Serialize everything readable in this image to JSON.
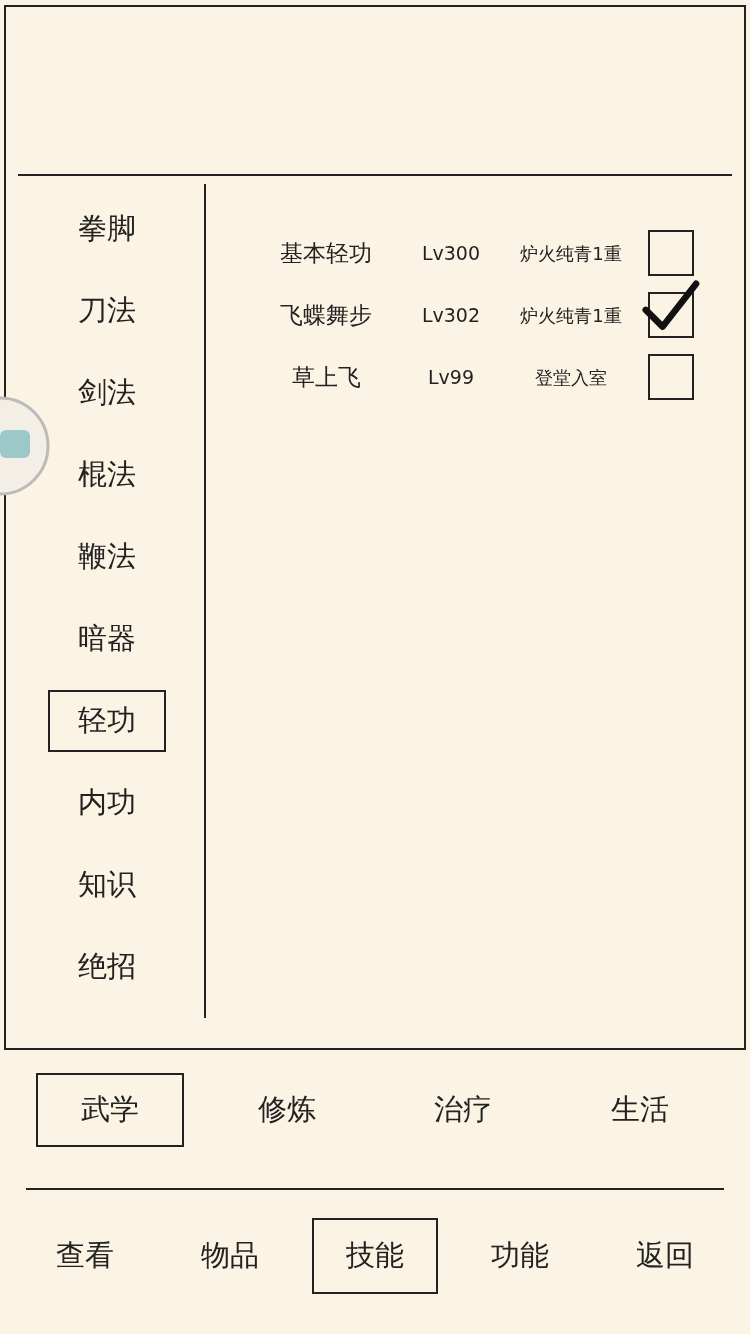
{
  "categories": [
    {
      "label": "拳脚",
      "selected": false
    },
    {
      "label": "刀法",
      "selected": false
    },
    {
      "label": "剑法",
      "selected": false
    },
    {
      "label": "棍法",
      "selected": false
    },
    {
      "label": "鞭法",
      "selected": false
    },
    {
      "label": "暗器",
      "selected": false
    },
    {
      "label": "轻功",
      "selected": true
    },
    {
      "label": "内功",
      "selected": false
    },
    {
      "label": "知识",
      "selected": false
    },
    {
      "label": "绝招",
      "selected": false
    }
  ],
  "skills": [
    {
      "name": "基本轻功",
      "level": "Lv300",
      "rank": "炉火纯青1重",
      "checked": false
    },
    {
      "name": "飞蝶舞步",
      "level": "Lv302",
      "rank": "炉火纯青1重",
      "checked": true
    },
    {
      "name": "草上飞",
      "level": "Lv99",
      "rank": "登堂入室",
      "checked": false
    }
  ],
  "tabs": [
    {
      "label": "武学",
      "selected": true
    },
    {
      "label": "修炼",
      "selected": false
    },
    {
      "label": "治疗",
      "selected": false
    },
    {
      "label": "生活",
      "selected": false
    }
  ],
  "nav": [
    {
      "label": "查看",
      "selected": false
    },
    {
      "label": "物品",
      "selected": false
    },
    {
      "label": "技能",
      "selected": true
    },
    {
      "label": "功能",
      "selected": false
    },
    {
      "label": "返回",
      "selected": false
    }
  ]
}
